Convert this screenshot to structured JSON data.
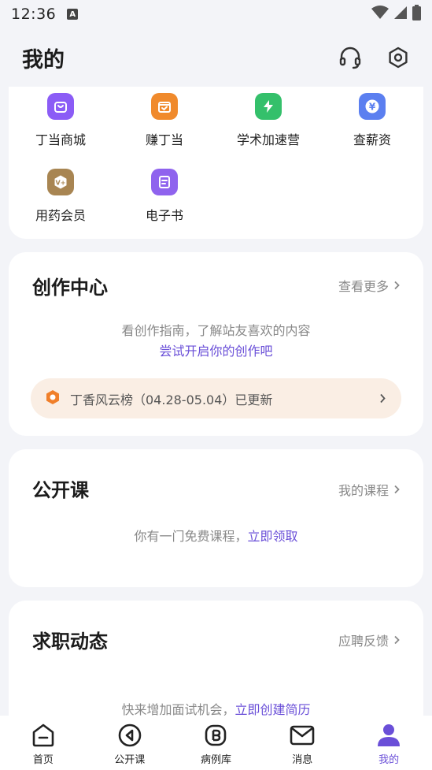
{
  "status_bar": {
    "time": "12:36",
    "a_badge": "A"
  },
  "header": {
    "title": "我的",
    "icons": [
      "headset-icon",
      "settings-icon"
    ]
  },
  "grid": {
    "items": [
      {
        "label": "丁当商城",
        "icon": "shopping-bag-icon",
        "color": "#8b5cf6"
      },
      {
        "label": "赚丁当",
        "icon": "wallet-icon",
        "color": "#f08a2c"
      },
      {
        "label": "学术加速营",
        "icon": "lightning-icon",
        "color": "#34c06b"
      },
      {
        "label": "查薪资",
        "icon": "yen-icon",
        "color": "#5b7ff0"
      },
      {
        "label": "用药会员",
        "icon": "vip-icon",
        "color": "#a88552"
      },
      {
        "label": "电子书",
        "icon": "ebook-icon",
        "color": "#8f63ee"
      }
    ]
  },
  "creation": {
    "title": "创作中心",
    "more": "查看更多",
    "hint": "看创作指南，了解站友喜欢的内容",
    "cta": "尝试开启你的创作吧",
    "rank": {
      "text": "丁香风云榜（04.28-05.04）已更新",
      "badge_color": "#f07f2a"
    }
  },
  "open_course": {
    "title": "公开课",
    "link": "我的课程",
    "hint": "你有一门免费课程，",
    "cta": "立即领取"
  },
  "job": {
    "title": "求职动态",
    "link": "应聘反馈",
    "hint": "快来增加面试机会，",
    "cta": "立即创建简历"
  },
  "bottom_nav": {
    "items": [
      {
        "label": "首页",
        "icon": "home-icon",
        "active": false
      },
      {
        "label": "公开课",
        "icon": "play-icon",
        "active": false
      },
      {
        "label": "病例库",
        "icon": "case-library-icon",
        "active": false
      },
      {
        "label": "消息",
        "icon": "mail-icon",
        "active": false
      },
      {
        "label": "我的",
        "icon": "profile-icon",
        "active": true
      }
    ]
  },
  "colors": {
    "accent": "#6a4fd8",
    "background": "#f3f4f8"
  }
}
